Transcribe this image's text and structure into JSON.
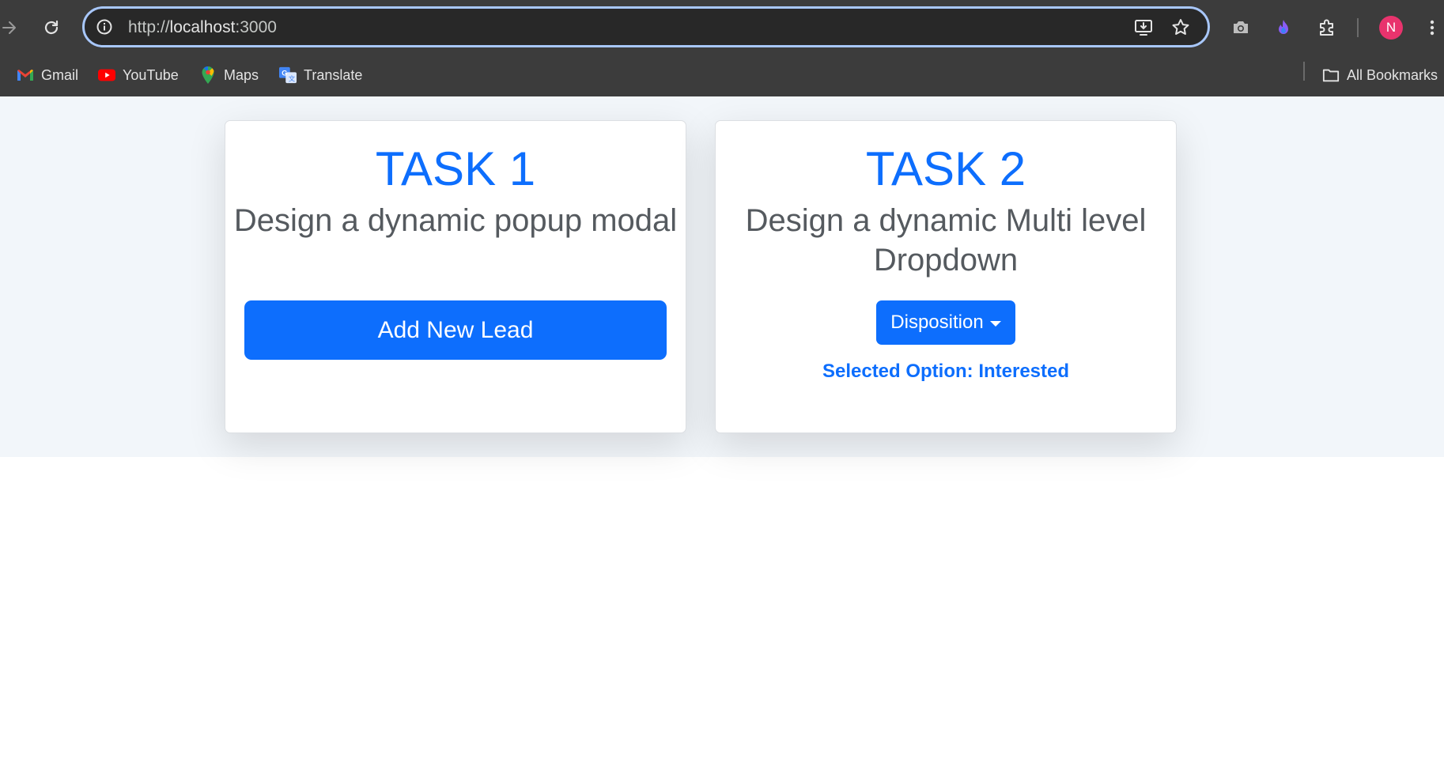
{
  "browser": {
    "url_scheme": "http://",
    "url_host": "localhost",
    "url_port": ":3000",
    "profile_initial": "N",
    "profile_color": "#e8336d",
    "toolbar_icons": [
      "forward-icon",
      "reload-icon",
      "site-info-icon",
      "install-app-icon",
      "bookmark-star-icon",
      "camera-icon",
      "extension-flame-icon",
      "extensions-puzzle-icon",
      "more-menu-icon"
    ]
  },
  "bookmarks": {
    "items": [
      {
        "label": "Gmail",
        "icon": "gmail-icon"
      },
      {
        "label": "YouTube",
        "icon": "youtube-icon"
      },
      {
        "label": "Maps",
        "icon": "maps-icon"
      },
      {
        "label": "Translate",
        "icon": "translate-icon"
      }
    ],
    "all_bookmarks": "All Bookmarks"
  },
  "colors": {
    "accent": "#0d6efd",
    "page_background": "#f2f6fa",
    "chrome_background": "#3c3c3c",
    "subtitle_text": "#555a5f"
  },
  "cards": [
    {
      "title": "TASK 1",
      "subtitle": "Design a dynamic popup modal",
      "button_label": "Add New Lead"
    },
    {
      "title": "TASK 2",
      "subtitle": "Design a dynamic Multi level Dropdown",
      "dropdown_label": "Disposition",
      "selected_prefix": "Selected Option: ",
      "selected_value": "Interested"
    }
  ]
}
